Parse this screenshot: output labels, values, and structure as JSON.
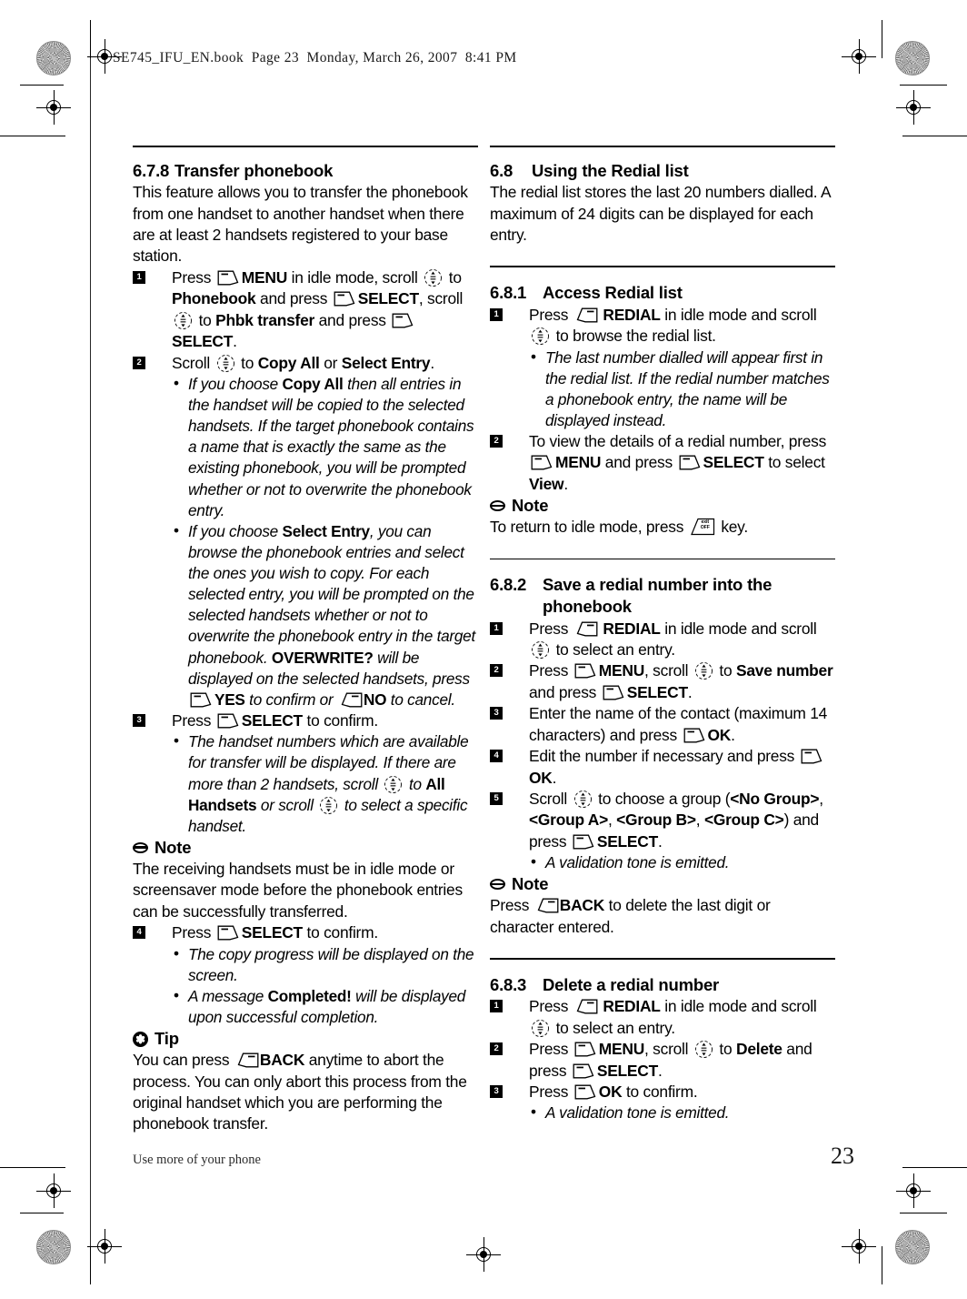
{
  "print_slug": "SE745_IFU_EN.book  Page 23  Monday, March 26, 2007  8:41 PM",
  "footer": {
    "running_head": "Use more of your phone",
    "page_number": "23"
  },
  "icons": {
    "left_softkey": "left-softkey-icon",
    "right_softkey": "right-softkey-icon",
    "scroll_key": "scroll-navigation-key-icon",
    "exit_off_key": "exit-off-key-icon",
    "exit_off_label_line1": "exit",
    "exit_off_label_line2": "OFF",
    "note": "note-icon",
    "tip": "tip-icon",
    "tip_glyph": "✽"
  },
  "left_column": {
    "section": {
      "number": "6.7.8",
      "title": "Transfer phonebook"
    },
    "intro": "This feature allows you to transfer the phonebook from one handset to another handset when there are at least 2 handsets registered to your base station.",
    "steps": [
      {
        "num": "1",
        "parts": [
          {
            "t": "text",
            "v": "Press "
          },
          {
            "t": "softkey-left"
          },
          {
            "t": "bold",
            "v": "MENU"
          },
          {
            "t": "text",
            "v": " in idle mode, scroll "
          },
          {
            "t": "scroll"
          },
          {
            "t": "text",
            "v": " to "
          },
          {
            "t": "bold",
            "v": "Phonebook"
          },
          {
            "t": "text",
            "v": " and press "
          },
          {
            "t": "softkey-left"
          },
          {
            "t": "bold",
            "v": "SELECT"
          },
          {
            "t": "text",
            "v": ", scroll "
          },
          {
            "t": "scroll"
          },
          {
            "t": "text",
            "v": " to "
          },
          {
            "t": "bold",
            "v": "Phbk transfer"
          },
          {
            "t": "text",
            "v": " and press "
          },
          {
            "t": "softkey-left"
          },
          {
            "t": "bold",
            "v": "SELECT"
          },
          {
            "t": "text",
            "v": "."
          }
        ],
        "subs": []
      },
      {
        "num": "2",
        "parts": [
          {
            "t": "text",
            "v": "Scroll "
          },
          {
            "t": "scroll"
          },
          {
            "t": "text",
            "v": " to "
          },
          {
            "t": "bold",
            "v": "Copy All"
          },
          {
            "t": "text",
            "v": " or "
          },
          {
            "t": "bold",
            "v": "Select Entry"
          },
          {
            "t": "text",
            "v": "."
          }
        ],
        "subs": [
          [
            {
              "t": "italic",
              "v": "If you choose "
            },
            {
              "t": "bold",
              "v": "Copy All"
            },
            {
              "t": "italic",
              "v": " then all entries in the handset will be copied to the selected handsets. If the target phonebook contains a name that is exactly the same as the existing phonebook, you will be prompted whether or not to overwrite the phonebook entry."
            }
          ],
          [
            {
              "t": "italic",
              "v": "If you choose "
            },
            {
              "t": "bold",
              "v": "Select Entry"
            },
            {
              "t": "italic",
              "v": ", you can browse the phonebook entries and select the ones you wish to copy. For each selected entry, you will be prompted on the selected handsets whether or not to overwrite the phonebook entry in the target phonebook. "
            },
            {
              "t": "bold",
              "v": "OVERWRITE?"
            },
            {
              "t": "italic",
              "v": " will be displayed on the selected handsets, press "
            },
            {
              "t": "softkey-left"
            },
            {
              "t": "bold",
              "v": "YES"
            },
            {
              "t": "italic",
              "v": " to confirm or "
            },
            {
              "t": "softkey-right"
            },
            {
              "t": "bold",
              "v": "NO"
            },
            {
              "t": "italic",
              "v": " to cancel."
            }
          ]
        ]
      },
      {
        "num": "3",
        "parts": [
          {
            "t": "text",
            "v": "Press "
          },
          {
            "t": "softkey-left"
          },
          {
            "t": "bold",
            "v": "SELECT"
          },
          {
            "t": "text",
            "v": " to confirm."
          }
        ],
        "subs": [
          [
            {
              "t": "italic",
              "v": "The handset numbers which are available for transfer will be displayed. If there are more than 2 handsets, scroll "
            },
            {
              "t": "scroll"
            },
            {
              "t": "italic",
              "v": " to "
            },
            {
              "t": "bold",
              "v": "All Handsets"
            },
            {
              "t": "italic",
              "v": " or scroll "
            },
            {
              "t": "scroll"
            },
            {
              "t": "italic",
              "v": " to select a specific handset."
            }
          ]
        ]
      }
    ],
    "note1": {
      "title": "Note",
      "body": "The receiving handsets must be in idle mode or screensaver mode before the phonebook entries can be successfully transferred."
    },
    "step4": {
      "num": "4",
      "parts": [
        {
          "t": "text",
          "v": "Press "
        },
        {
          "t": "softkey-left"
        },
        {
          "t": "bold",
          "v": "SELECT"
        },
        {
          "t": "text",
          "v": " to confirm."
        }
      ],
      "subs": [
        [
          {
            "t": "italic",
            "v": "The copy progress will be displayed on the screen."
          }
        ],
        [
          {
            "t": "italic",
            "v": "A message "
          },
          {
            "t": "bold",
            "v": "Completed!"
          },
          {
            "t": "italic",
            "v": " will be displayed upon successful completion."
          }
        ]
      ]
    },
    "tip": {
      "title": "Tip",
      "parts": [
        {
          "t": "text",
          "v": "You can press "
        },
        {
          "t": "softkey-right"
        },
        {
          "t": "bold",
          "v": "BACK"
        },
        {
          "t": "text",
          "v": " anytime to abort the process. You can only abort this process from the original handset which you are performing the phonebook transfer."
        }
      ]
    }
  },
  "right_column": {
    "section": {
      "number": "6.8",
      "title": "Using the Redial list"
    },
    "intro": "The redial list stores the last 20 numbers dialled. A maximum of 24 digits can be displayed for each entry.",
    "sub1": {
      "number": "6.8.1",
      "title": "Access Redial list",
      "steps": [
        {
          "num": "1",
          "parts": [
            {
              "t": "text",
              "v": "Press "
            },
            {
              "t": "softkey-right"
            },
            {
              "t": "text",
              "v": " "
            },
            {
              "t": "bold",
              "v": "REDIAL"
            },
            {
              "t": "text",
              "v": " in idle mode and scroll "
            },
            {
              "t": "scroll"
            },
            {
              "t": "text",
              "v": " to browse the redial list."
            }
          ],
          "subs": [
            [
              {
                "t": "italic",
                "v": "The last number dialled will appear first in the redial list. If the redial number matches a phonebook entry, the name will be displayed instead."
              }
            ]
          ]
        },
        {
          "num": "2",
          "parts": [
            {
              "t": "text",
              "v": "To view the details of a redial number, press "
            },
            {
              "t": "softkey-left"
            },
            {
              "t": "bold",
              "v": "MENU"
            },
            {
              "t": "text",
              "v": " and press "
            },
            {
              "t": "softkey-left"
            },
            {
              "t": "bold",
              "v": "SELECT"
            },
            {
              "t": "text",
              "v": " to select "
            },
            {
              "t": "bold",
              "v": "View"
            },
            {
              "t": "text",
              "v": "."
            }
          ],
          "subs": []
        }
      ]
    },
    "note1": {
      "title": "Note",
      "parts": [
        {
          "t": "text",
          "v": "To return to idle mode, press "
        },
        {
          "t": "exitkey"
        },
        {
          "t": "text",
          "v": " key."
        }
      ]
    },
    "sub2": {
      "number": "6.8.2",
      "title_line1": "Save a redial number into the",
      "title_line2": "phonebook",
      "steps": [
        {
          "num": "1",
          "parts": [
            {
              "t": "text",
              "v": "Press "
            },
            {
              "t": "softkey-right"
            },
            {
              "t": "text",
              "v": " "
            },
            {
              "t": "bold",
              "v": "REDIAL"
            },
            {
              "t": "text",
              "v": " in idle mode and scroll "
            },
            {
              "t": "scroll"
            },
            {
              "t": "text",
              "v": " to select an entry."
            }
          ],
          "subs": []
        },
        {
          "num": "2",
          "parts": [
            {
              "t": "text",
              "v": "Press "
            },
            {
              "t": "softkey-left"
            },
            {
              "t": "bold",
              "v": "MENU"
            },
            {
              "t": "text",
              "v": ", scroll "
            },
            {
              "t": "scroll"
            },
            {
              "t": "text",
              "v": " to "
            },
            {
              "t": "bold",
              "v": "Save number"
            },
            {
              "t": "text",
              "v": " and press "
            },
            {
              "t": "softkey-left"
            },
            {
              "t": "bold",
              "v": "SELECT"
            },
            {
              "t": "text",
              "v": "."
            }
          ],
          "subs": []
        },
        {
          "num": "3",
          "parts": [
            {
              "t": "text",
              "v": "Enter the name of the contact (maximum 14 characters) and press "
            },
            {
              "t": "softkey-left"
            },
            {
              "t": "bold",
              "v": "OK"
            },
            {
              "t": "text",
              "v": "."
            }
          ],
          "subs": []
        },
        {
          "num": "4",
          "parts": [
            {
              "t": "text",
              "v": "Edit the number if necessary and press "
            },
            {
              "t": "softkey-left"
            },
            {
              "t": "bold",
              "v": "OK"
            },
            {
              "t": "text",
              "v": "."
            }
          ],
          "subs": []
        },
        {
          "num": "5",
          "parts": [
            {
              "t": "text",
              "v": "Scroll "
            },
            {
              "t": "scroll"
            },
            {
              "t": "text",
              "v": " to choose a group ("
            },
            {
              "t": "bold",
              "v": "<No Group>"
            },
            {
              "t": "text",
              "v": ", "
            },
            {
              "t": "bold",
              "v": "<Group A>"
            },
            {
              "t": "text",
              "v": ", "
            },
            {
              "t": "bold",
              "v": "<Group B>"
            },
            {
              "t": "text",
              "v": ", "
            },
            {
              "t": "bold",
              "v": "<Group C>"
            },
            {
              "t": "text",
              "v": ") and press "
            },
            {
              "t": "softkey-left"
            },
            {
              "t": "bold",
              "v": "SELECT"
            },
            {
              "t": "text",
              "v": "."
            }
          ],
          "subs": [
            [
              {
                "t": "italic",
                "v": "A validation tone is emitted."
              }
            ]
          ]
        }
      ]
    },
    "note2": {
      "title": "Note",
      "parts": [
        {
          "t": "text",
          "v": "Press "
        },
        {
          "t": "softkey-right"
        },
        {
          "t": "bold",
          "v": "BACK"
        },
        {
          "t": "text",
          "v": " to delete the last digit or character entered."
        }
      ]
    },
    "sub3": {
      "number": "6.8.3",
      "title": "Delete a redial number",
      "steps": [
        {
          "num": "1",
          "parts": [
            {
              "t": "text",
              "v": "Press "
            },
            {
              "t": "softkey-right"
            },
            {
              "t": "text",
              "v": " "
            },
            {
              "t": "bold",
              "v": "REDIAL"
            },
            {
              "t": "text",
              "v": " in idle mode and scroll "
            },
            {
              "t": "scroll"
            },
            {
              "t": "text",
              "v": " to select an entry."
            }
          ],
          "subs": []
        },
        {
          "num": "2",
          "parts": [
            {
              "t": "text",
              "v": "Press "
            },
            {
              "t": "softkey-left"
            },
            {
              "t": "bold",
              "v": "MENU"
            },
            {
              "t": "text",
              "v": ", scroll "
            },
            {
              "t": "scroll"
            },
            {
              "t": "text",
              "v": " to "
            },
            {
              "t": "bold",
              "v": "Delete"
            },
            {
              "t": "text",
              "v": " and press "
            },
            {
              "t": "softkey-left"
            },
            {
              "t": "bold",
              "v": "SELECT"
            },
            {
              "t": "text",
              "v": "."
            }
          ],
          "subs": []
        },
        {
          "num": "3",
          "parts": [
            {
              "t": "text",
              "v": "Press "
            },
            {
              "t": "softkey-left"
            },
            {
              "t": "bold",
              "v": "OK"
            },
            {
              "t": "text",
              "v": " to confirm."
            }
          ],
          "subs": [
            [
              {
                "t": "italic",
                "v": "A validation tone is emitted."
              }
            ]
          ]
        }
      ]
    }
  }
}
